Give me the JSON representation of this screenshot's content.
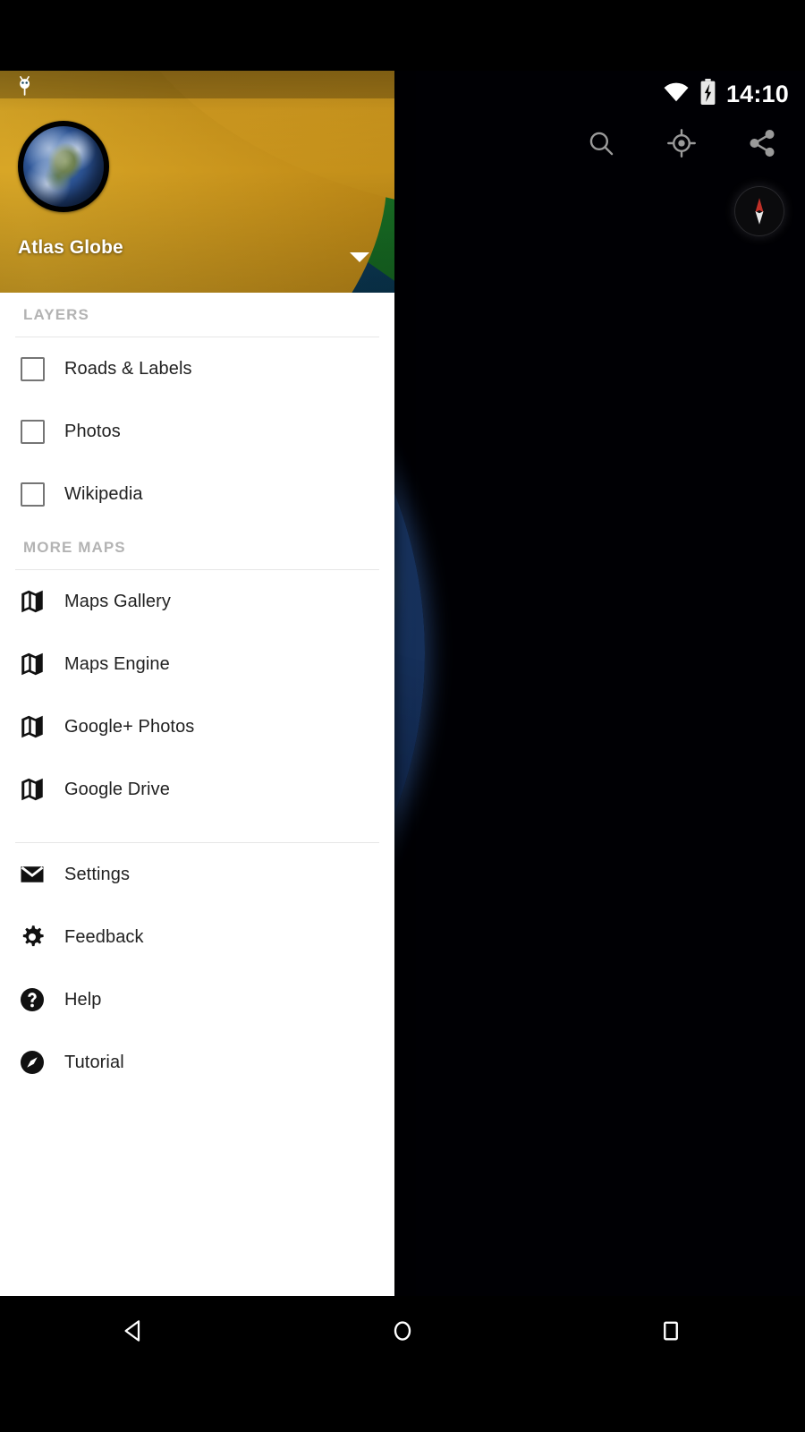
{
  "statusbar": {
    "time": "14:10",
    "icons": [
      "bug-notification-icon",
      "wifi-icon",
      "battery-charging-icon"
    ]
  },
  "map": {
    "scene": "earth-globe-asia",
    "actions": [
      {
        "name": "search-icon",
        "label": "Search"
      },
      {
        "name": "my-location-icon",
        "label": "My Location"
      },
      {
        "name": "share-icon",
        "label": "Share"
      }
    ],
    "compass": {
      "name": "compass-button",
      "label": "Compass",
      "north_color": "#c03028",
      "south_color": "#e8e8e8"
    }
  },
  "drawer": {
    "account": {
      "title": "Atlas Globe",
      "avatar": "earth-avatar",
      "caret": "chevron-down-icon"
    },
    "sections": [
      {
        "label": "LAYERS",
        "type": "checkbox",
        "items": [
          {
            "label": "Roads & Labels",
            "checked": false
          },
          {
            "label": "Photos",
            "checked": false
          },
          {
            "label": "Wikipedia",
            "checked": false
          }
        ]
      },
      {
        "label": "MORE MAPS",
        "type": "icon",
        "items": [
          {
            "label": "Maps Gallery",
            "icon": "map-icon"
          },
          {
            "label": "Maps Engine",
            "icon": "map-icon"
          },
          {
            "label": "Google+ Photos",
            "icon": "map-icon"
          },
          {
            "label": "Google Drive",
            "icon": "map-icon"
          }
        ]
      },
      {
        "label": "",
        "type": "icon",
        "items": [
          {
            "label": "Settings",
            "icon": "envelope-icon"
          },
          {
            "label": "Feedback",
            "icon": "gear-icon"
          },
          {
            "label": "Help",
            "icon": "help-circle-icon"
          },
          {
            "label": "Tutorial",
            "icon": "compass-circle-icon"
          }
        ]
      }
    ]
  },
  "navbar": {
    "buttons": [
      {
        "name": "back-button",
        "label": "Back"
      },
      {
        "name": "home-button",
        "label": "Home"
      },
      {
        "name": "recents-button",
        "label": "Recents"
      }
    ]
  },
  "colors": {
    "drawer_bg": "#ffffff",
    "header_teal": "#0d4461",
    "header_yellow": "#d29b1d",
    "header_blue": "#1d5f8e",
    "header_red": "#b33a22",
    "header_green": "#176b23",
    "item_text": "#212121",
    "section_text": "#b3b3b3",
    "map_space": "#000004"
  }
}
